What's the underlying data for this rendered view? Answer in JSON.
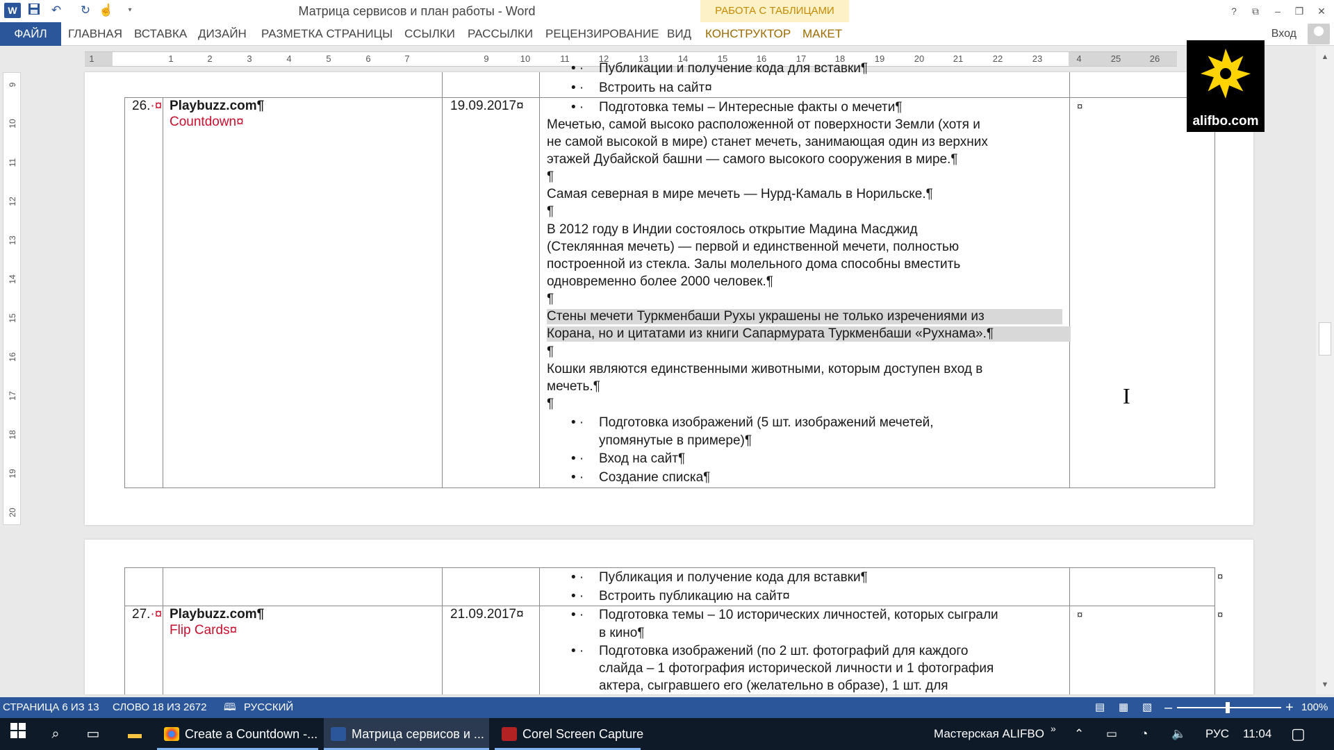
{
  "window": {
    "title": "Матрица сервисов и план работы - Word",
    "context_group": "РАБОТА С ТАБЛИЦАМИ",
    "controls": [
      "?",
      "⧉",
      "–",
      "❐",
      "✕"
    ]
  },
  "ribbon": {
    "file": "ФАЙЛ",
    "tabs": [
      "ГЛАВНАЯ",
      "ВСТАВКА",
      "ДИЗАЙН",
      "РАЗМЕТКА СТРАНИЦЫ",
      "ССЫЛКИ",
      "РАССЫЛКИ",
      "РЕЦЕНЗИРОВАНИЕ",
      "ВИД",
      "КОНСТРУКТОР",
      "МАКЕТ"
    ],
    "signin": "Вход"
  },
  "ruler": {
    "h_ticks": [
      "1",
      "1",
      "2",
      "3",
      "4",
      "5",
      "6",
      "7",
      "9",
      "10",
      "11",
      "12",
      "13",
      "14",
      "15",
      "16",
      "17",
      "18",
      "19",
      "20",
      "21",
      "22",
      "23",
      "4",
      "25",
      "26"
    ],
    "v_ticks": [
      "9",
      "10",
      "11",
      "12",
      "13",
      "14",
      "15",
      "16",
      "17",
      "18",
      "19",
      "20"
    ],
    "corner": "L"
  },
  "page1": {
    "prev_row": {
      "bullets": [
        "Публикации и получение кода для вставки¶",
        "Встроить на сайт¤"
      ]
    },
    "row26": {
      "number": "26.",
      "service": "Playbuzz.com¶",
      "format": "Countdown¤",
      "date": "19.09.2017¤",
      "topic_bullet": "Подготовка темы – Интересные факты о мечети¶",
      "paragraphs": [
        "Мечетью, самой высоко расположенной от поверхности Земли (хотя и",
        "не самой высокой в мире) станет мечеть, занимающая один из верхних",
        "этажей Дубайской башни — самого высокого сооружения в мире.¶",
        "¶",
        "Самая северная в мире мечеть — Нурд-Камаль в Норильске.¶",
        "¶",
        "В 2012 году в Индии состоялось открытие Мадина Масджид",
        "(Стеклянная мечеть) — первой и единственной мечети, полностью",
        "построенной из стекла. Залы молельного дома способны вместить",
        "одновременно более 2000 человек.¶",
        "¶"
      ],
      "highlighted": [
        "Стены мечети Туркменбаши Рухы украшены не только изречениями из",
        "Корана, но и цитатами из книги Сапармурата Туркменбаши «Рухнама».¶"
      ],
      "paragraphs2": [
        "¶",
        "Кошки являются единственными животными, которым доступен вход в",
        "мечеть.¶",
        "¶"
      ],
      "bullets": [
        "Подготовка изображений (5 шт. изображений мечетей,",
        "упомянутые в примере)¶",
        "Вход на сайт¶",
        "Создание списка¶"
      ],
      "cell_end": "¤"
    }
  },
  "page2": {
    "cont_row": {
      "bullets": [
        "Публикация и получение кода для вставки¶",
        "Встроить публикацию на сайт¤"
      ],
      "end": "¤"
    },
    "row27": {
      "number": "27.",
      "service": "Playbuzz.com¶",
      "format": "Flip Cards¤",
      "date": "21.09.2017¤",
      "bullets": [
        "Подготовка темы – 10 исторических личностей, которых сыграли",
        "в кино¶",
        "Подготовка изображений (по 2 шт. фотографий для каждого",
        "слайда – 1 фотография исторической личности и 1 фотография",
        "актера, сыгравшего его (желательно в образе), 1 шт. для"
      ],
      "cell_end": "¤",
      "end": "¤"
    }
  },
  "logo": {
    "text": "alifbo.com",
    "color": "#ffd400"
  },
  "statusbar": {
    "page": "СТРАНИЦА 6 ИЗ 13",
    "words": "СЛОВО 18 ИЗ 2672",
    "language": "РУССКИЙ",
    "zoom": "100%",
    "zoom_minus": "–",
    "zoom_plus": "+"
  },
  "taskbar": {
    "apps": [
      {
        "label": "Create a Countdown -...",
        "active": false
      },
      {
        "label": "Матрица сервисов и ...",
        "active": true
      },
      {
        "label": "Corel Screen Capture",
        "active": false
      }
    ],
    "tray_label": "Мастерская ALIFBO",
    "tray_more": "»",
    "language": "РУС",
    "time": "11:04"
  },
  "colors": {
    "word_blue": "#2b579a",
    "taskbar": "#0f1a28",
    "context_tab": "#fdf1c8",
    "red_text": "#c8102e"
  }
}
